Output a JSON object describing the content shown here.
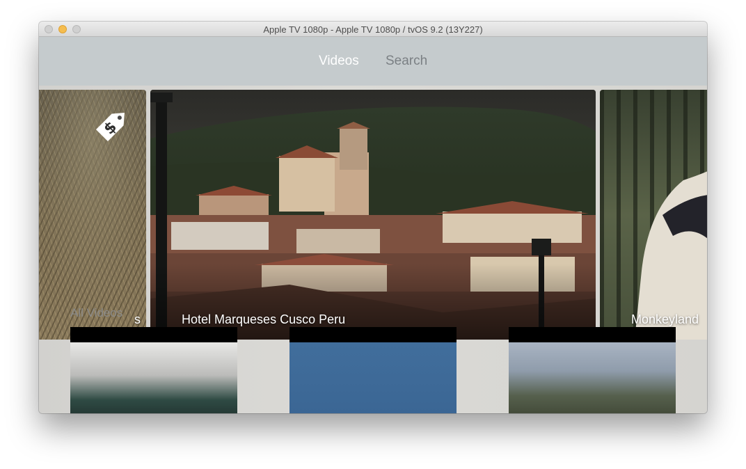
{
  "window": {
    "title": "Apple TV 1080p - Apple TV 1080p / tvOS 9.2 (13Y227)"
  },
  "nav": {
    "tabs": [
      {
        "label": "Videos",
        "active": true
      },
      {
        "label": "Search",
        "active": false
      }
    ]
  },
  "featured": {
    "items": [
      {
        "label": "s",
        "badge": "price-tag-icon"
      },
      {
        "label": "Hotel Marqueses Cusco Peru"
      },
      {
        "label": "Monkeyland"
      }
    ]
  },
  "all_videos": {
    "title": "All Videos"
  },
  "colors": {
    "nav_background": "#c5cbcd",
    "active_tab": "#ffffff",
    "inactive_tab": "#7b8084",
    "traffic_minimize": "#f5bd4f"
  }
}
